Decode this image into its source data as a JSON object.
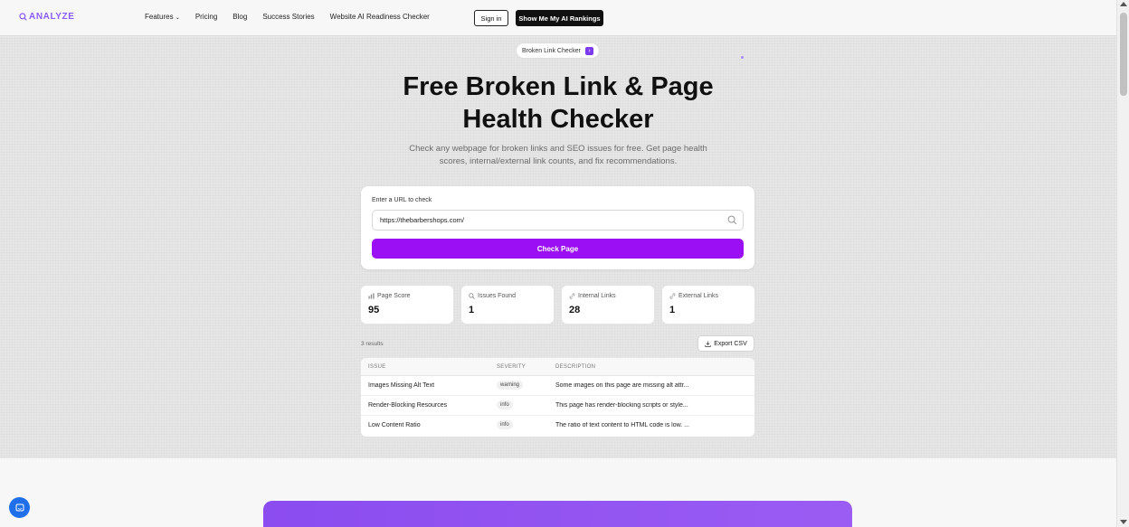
{
  "header": {
    "logo_text": "ANALYZE",
    "nav": [
      "Features",
      "Pricing",
      "Blog",
      "Success Stories",
      "Website AI Readiness Checker"
    ],
    "signin_label": "Sign in",
    "cta_label": "Show Me My AI Rankings"
  },
  "hero": {
    "badge": "Broken Link Checker",
    "title_line1": "Free Broken Link & Page",
    "title_line2": "Health Checker",
    "subtitle_line1": "Check any webpage for broken links and SEO issues for free. Get page health",
    "subtitle_line2": "scores, internal/external link counts, and fix recommendations."
  },
  "form": {
    "label": "Enter a URL to check",
    "url_value": "https://thebarbershops.com/",
    "button_label": "Check Page"
  },
  "stats": [
    {
      "label": "Page Score",
      "value": "95"
    },
    {
      "label": "Issues Found",
      "value": "1"
    },
    {
      "label": "Internal Links",
      "value": "28"
    },
    {
      "label": "External Links",
      "value": "1"
    }
  ],
  "results": {
    "count_text": "3 results",
    "export_label": "Export CSV",
    "headers": [
      "ISSUE",
      "SEVERITY",
      "DESCRIPTION"
    ],
    "rows": [
      {
        "issue": "Images Missing Alt Text",
        "severity": "warning",
        "description": "Some images on this page are missing alt attr..."
      },
      {
        "issue": "Render-Blocking Resources",
        "severity": "info",
        "description": "This page has render-blocking scripts or style..."
      },
      {
        "issue": "Low Content Ratio",
        "severity": "info",
        "description": "The ratio of text content to HTML code is low. ..."
      }
    ]
  },
  "colors": {
    "accent": "#9b0ff5",
    "logo": "#8b5cf6",
    "cta_bg": "#111111"
  }
}
